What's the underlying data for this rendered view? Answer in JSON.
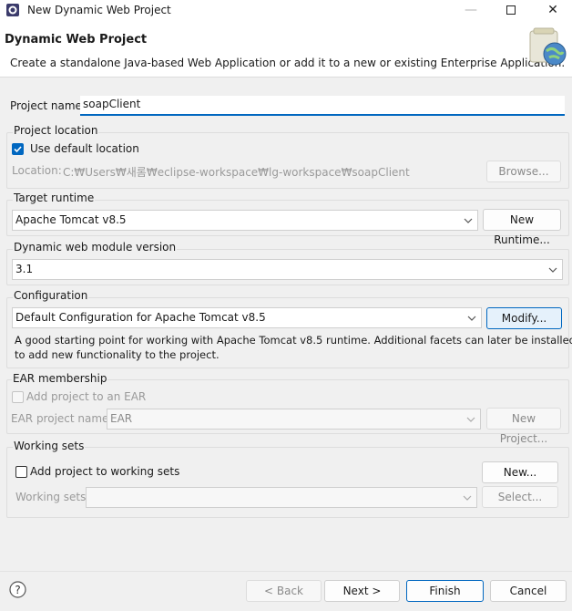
{
  "window": {
    "title": "New Dynamic Web Project",
    "minimize_icon": "minimize-icon",
    "maximize_icon": "maximize-icon",
    "close_icon": "close-icon"
  },
  "header": {
    "title": "Dynamic Web Project",
    "description": "Create a standalone Java-based Web Application or add it to a new or existing Enterprise Application."
  },
  "project_name": {
    "label": "Project name:",
    "value": "soapClient"
  },
  "project_location": {
    "group_label": "Project location",
    "use_default_label": "Use default location",
    "use_default_checked": true,
    "location_label": "Location:",
    "location_value": "C:₩Users₩새롬₩eclipse-workspace₩lg-workspace₩soapClient",
    "browse_label": "Browse..."
  },
  "target_runtime": {
    "group_label": "Target runtime",
    "selected": "Apache Tomcat v8.5",
    "new_runtime_label": "New Runtime..."
  },
  "web_module": {
    "group_label": "Dynamic web module version",
    "selected": "3.1"
  },
  "configuration": {
    "group_label": "Configuration",
    "selected": "Default Configuration for Apache Tomcat v8.5",
    "modify_label": "Modify...",
    "description_line1": "A good starting point for working with Apache Tomcat v8.5 runtime. Additional facets can later be installed",
    "description_line2": "to add new functionality to the project."
  },
  "ear": {
    "group_label": "EAR membership",
    "add_label": "Add project to an EAR",
    "project_name_label": "EAR project name:",
    "project_name_value": "EAR",
    "new_project_label": "New Project..."
  },
  "working_sets": {
    "group_label": "Working sets",
    "add_label": "Add project to working sets",
    "new_label": "New...",
    "sets_label": "Working sets:",
    "select_label": "Select..."
  },
  "footer": {
    "help_icon": "help-icon",
    "back_label": "< Back",
    "next_label": "Next >",
    "finish_label": "Finish",
    "cancel_label": "Cancel"
  },
  "colors": {
    "accent": "#0067c0",
    "background": "#f0f0f0"
  }
}
